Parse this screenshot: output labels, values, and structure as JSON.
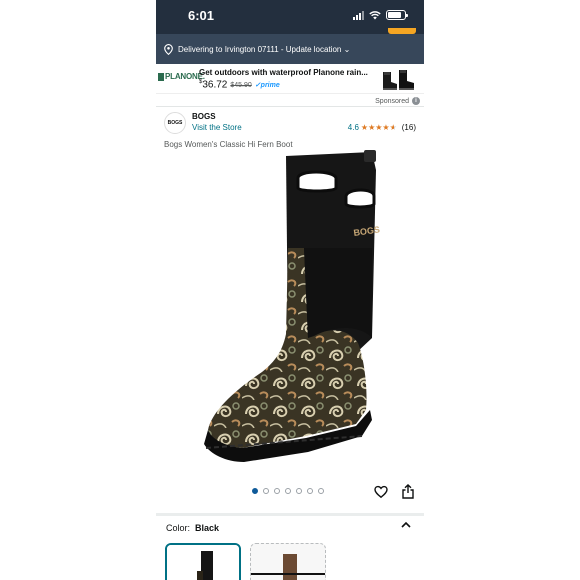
{
  "status_bar": {
    "time": "6:01"
  },
  "delivery": {
    "text": "Delivering to Irvington 07111 - Update location ⌄"
  },
  "ad": {
    "logo": "PLANONE.",
    "title": "Get outdoors with waterproof Planone rain...",
    "price_dollar": "$",
    "price_whole": "36.72",
    "list_price": "$45.90",
    "prime_label": "✓prime",
    "sponsored_label": "Sponsored"
  },
  "brand": {
    "logo_text": "BOGS",
    "name": "BOGS",
    "visit_store": "Visit the Store",
    "rating": "4.6",
    "stars": 4.6,
    "review_count": "(16)"
  },
  "product": {
    "title": "Bogs Women's Classic Hi Fern Boot"
  },
  "gallery": {
    "image_count": 7,
    "active_index": 0
  },
  "color": {
    "label": "Color:",
    "value": "Black"
  },
  "colors": {
    "accent": "#232f3e",
    "link": "#007185",
    "star": "#de7921",
    "active_dot": "#0f5a99"
  },
  "icons": [
    "wifi-icon",
    "location-pin-icon",
    "info-icon",
    "heart-icon",
    "share-icon",
    "chevron-up-icon"
  ]
}
